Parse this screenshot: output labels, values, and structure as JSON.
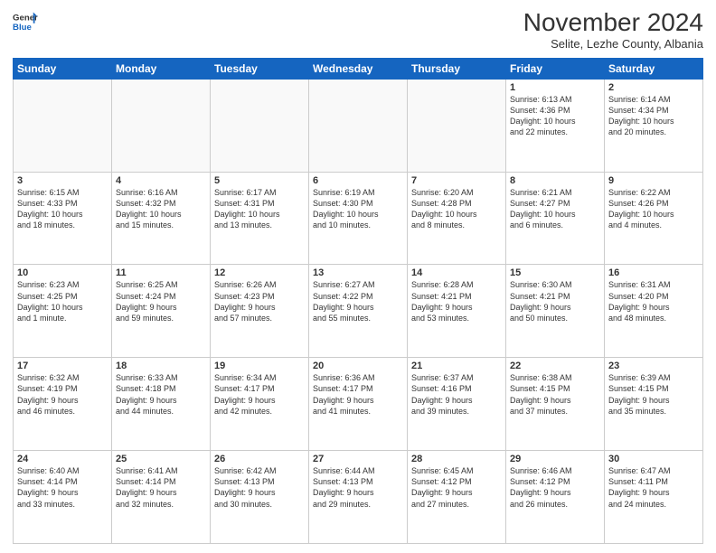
{
  "logo": {
    "line1": "General",
    "line2": "Blue"
  },
  "title": "November 2024",
  "subtitle": "Selite, Lezhe County, Albania",
  "weekdays": [
    "Sunday",
    "Monday",
    "Tuesday",
    "Wednesday",
    "Thursday",
    "Friday",
    "Saturday"
  ],
  "weeks": [
    [
      {
        "day": "",
        "info": ""
      },
      {
        "day": "",
        "info": ""
      },
      {
        "day": "",
        "info": ""
      },
      {
        "day": "",
        "info": ""
      },
      {
        "day": "",
        "info": ""
      },
      {
        "day": "1",
        "info": "Sunrise: 6:13 AM\nSunset: 4:36 PM\nDaylight: 10 hours\nand 22 minutes."
      },
      {
        "day": "2",
        "info": "Sunrise: 6:14 AM\nSunset: 4:34 PM\nDaylight: 10 hours\nand 20 minutes."
      }
    ],
    [
      {
        "day": "3",
        "info": "Sunrise: 6:15 AM\nSunset: 4:33 PM\nDaylight: 10 hours\nand 18 minutes."
      },
      {
        "day": "4",
        "info": "Sunrise: 6:16 AM\nSunset: 4:32 PM\nDaylight: 10 hours\nand 15 minutes."
      },
      {
        "day": "5",
        "info": "Sunrise: 6:17 AM\nSunset: 4:31 PM\nDaylight: 10 hours\nand 13 minutes."
      },
      {
        "day": "6",
        "info": "Sunrise: 6:19 AM\nSunset: 4:30 PM\nDaylight: 10 hours\nand 10 minutes."
      },
      {
        "day": "7",
        "info": "Sunrise: 6:20 AM\nSunset: 4:28 PM\nDaylight: 10 hours\nand 8 minutes."
      },
      {
        "day": "8",
        "info": "Sunrise: 6:21 AM\nSunset: 4:27 PM\nDaylight: 10 hours\nand 6 minutes."
      },
      {
        "day": "9",
        "info": "Sunrise: 6:22 AM\nSunset: 4:26 PM\nDaylight: 10 hours\nand 4 minutes."
      }
    ],
    [
      {
        "day": "10",
        "info": "Sunrise: 6:23 AM\nSunset: 4:25 PM\nDaylight: 10 hours\nand 1 minute."
      },
      {
        "day": "11",
        "info": "Sunrise: 6:25 AM\nSunset: 4:24 PM\nDaylight: 9 hours\nand 59 minutes."
      },
      {
        "day": "12",
        "info": "Sunrise: 6:26 AM\nSunset: 4:23 PM\nDaylight: 9 hours\nand 57 minutes."
      },
      {
        "day": "13",
        "info": "Sunrise: 6:27 AM\nSunset: 4:22 PM\nDaylight: 9 hours\nand 55 minutes."
      },
      {
        "day": "14",
        "info": "Sunrise: 6:28 AM\nSunset: 4:21 PM\nDaylight: 9 hours\nand 53 minutes."
      },
      {
        "day": "15",
        "info": "Sunrise: 6:30 AM\nSunset: 4:21 PM\nDaylight: 9 hours\nand 50 minutes."
      },
      {
        "day": "16",
        "info": "Sunrise: 6:31 AM\nSunset: 4:20 PM\nDaylight: 9 hours\nand 48 minutes."
      }
    ],
    [
      {
        "day": "17",
        "info": "Sunrise: 6:32 AM\nSunset: 4:19 PM\nDaylight: 9 hours\nand 46 minutes."
      },
      {
        "day": "18",
        "info": "Sunrise: 6:33 AM\nSunset: 4:18 PM\nDaylight: 9 hours\nand 44 minutes."
      },
      {
        "day": "19",
        "info": "Sunrise: 6:34 AM\nSunset: 4:17 PM\nDaylight: 9 hours\nand 42 minutes."
      },
      {
        "day": "20",
        "info": "Sunrise: 6:36 AM\nSunset: 4:17 PM\nDaylight: 9 hours\nand 41 minutes."
      },
      {
        "day": "21",
        "info": "Sunrise: 6:37 AM\nSunset: 4:16 PM\nDaylight: 9 hours\nand 39 minutes."
      },
      {
        "day": "22",
        "info": "Sunrise: 6:38 AM\nSunset: 4:15 PM\nDaylight: 9 hours\nand 37 minutes."
      },
      {
        "day": "23",
        "info": "Sunrise: 6:39 AM\nSunset: 4:15 PM\nDaylight: 9 hours\nand 35 minutes."
      }
    ],
    [
      {
        "day": "24",
        "info": "Sunrise: 6:40 AM\nSunset: 4:14 PM\nDaylight: 9 hours\nand 33 minutes."
      },
      {
        "day": "25",
        "info": "Sunrise: 6:41 AM\nSunset: 4:14 PM\nDaylight: 9 hours\nand 32 minutes."
      },
      {
        "day": "26",
        "info": "Sunrise: 6:42 AM\nSunset: 4:13 PM\nDaylight: 9 hours\nand 30 minutes."
      },
      {
        "day": "27",
        "info": "Sunrise: 6:44 AM\nSunset: 4:13 PM\nDaylight: 9 hours\nand 29 minutes."
      },
      {
        "day": "28",
        "info": "Sunrise: 6:45 AM\nSunset: 4:12 PM\nDaylight: 9 hours\nand 27 minutes."
      },
      {
        "day": "29",
        "info": "Sunrise: 6:46 AM\nSunset: 4:12 PM\nDaylight: 9 hours\nand 26 minutes."
      },
      {
        "day": "30",
        "info": "Sunrise: 6:47 AM\nSunset: 4:11 PM\nDaylight: 9 hours\nand 24 minutes."
      }
    ]
  ]
}
